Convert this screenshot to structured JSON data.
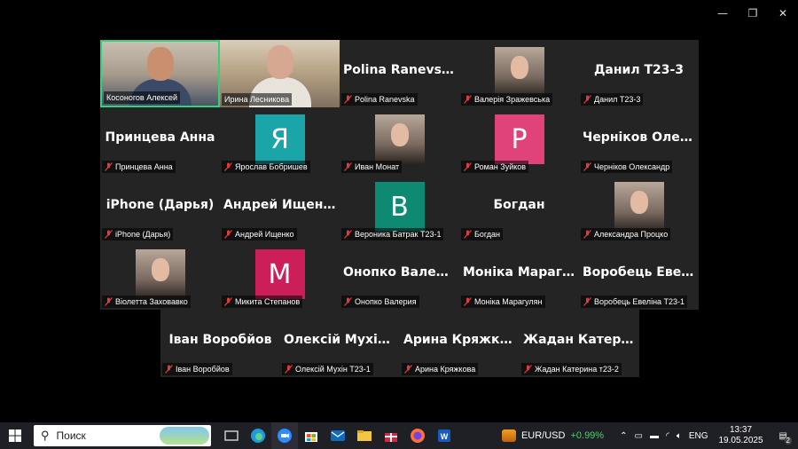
{
  "window": {
    "minimize": "—",
    "maximize": "❐",
    "close": "✕"
  },
  "participants": [
    {
      "name": "Косоногов Алексей",
      "type": "video",
      "speaking": true
    },
    {
      "name": "Ирина Лесникова",
      "type": "video"
    },
    {
      "name": "Polina Ranevska",
      "type": "name",
      "big": "Polina Ranevska"
    },
    {
      "name": "Валерія Зражевська",
      "type": "photo"
    },
    {
      "name": "Данил Т23-3",
      "type": "name",
      "big": "Данил Т23-3"
    },
    {
      "name": "Принцева Анна",
      "type": "name",
      "big": "Принцева Анна"
    },
    {
      "name": "Ярослав Бобришев",
      "type": "avatar",
      "letter": "Я",
      "color": "#1aa5a8"
    },
    {
      "name": "Иван Монат",
      "type": "photo"
    },
    {
      "name": "Роман Зуйков",
      "type": "avatar",
      "letter": "P",
      "color": "#e0437a"
    },
    {
      "name": "Черніков Олександр",
      "type": "name",
      "big": "Черніков Олек..."
    },
    {
      "name": "iPhone (Дарья)",
      "type": "name",
      "big": "iPhone (Дарья)"
    },
    {
      "name": "Андрей Ищенко",
      "type": "name",
      "big": "Андрей Ищенко"
    },
    {
      "name": "Вероника Батрак Т23-1",
      "type": "avatar",
      "letter": "B",
      "color": "#0e8a72"
    },
    {
      "name": "Богдан",
      "type": "name",
      "big": "Богдан"
    },
    {
      "name": "Александра Процко",
      "type": "photo"
    },
    {
      "name": "Віолетта Заховавко",
      "type": "photo"
    },
    {
      "name": "Микита Степанов",
      "type": "avatar",
      "letter": "M",
      "color": "#cc1f5a"
    },
    {
      "name": "Онопко Валерия",
      "type": "name",
      "big": "Онопко Валерия"
    },
    {
      "name": "Моніка Марагулян",
      "type": "name",
      "big": "Моніка Марагу..."
    },
    {
      "name": "Воробець Евеліна Т23-1",
      "type": "name",
      "big": "Воробець Евел..."
    },
    {
      "name": "Іван Воробйов",
      "type": "name",
      "big": "Іван Воробйов"
    },
    {
      "name": "Олексій Мухін Т23-1",
      "type": "name",
      "big": "Олексій Мухін..."
    },
    {
      "name": "Арина Кряжкова",
      "type": "name",
      "big": "Арина Кряжкова"
    },
    {
      "name": "Жадан Катерина т23-2",
      "type": "name",
      "big": "Жадан Катери..."
    }
  ],
  "taskbar": {
    "search_placeholder": "Поиск",
    "stock": "EUR/USD",
    "stock_change": "+0.99%",
    "lang": "ENG",
    "time": "13:37",
    "date": "19.05.2025",
    "notifications": "2"
  }
}
